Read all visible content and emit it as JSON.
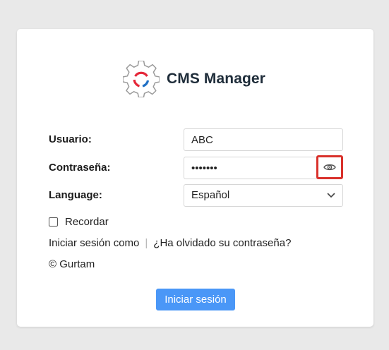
{
  "app": {
    "title": "CMS Manager"
  },
  "form": {
    "username": {
      "label": "Usuario:",
      "value": "ABC"
    },
    "password": {
      "label": "Contraseña:",
      "value": "1234567",
      "toggle_icon": "eye-icon"
    },
    "language": {
      "label": "Language:",
      "selected": "Español"
    },
    "remember": {
      "label": "Recordar",
      "checked": false
    },
    "links": {
      "login_as": "Iniciar sesión como",
      "separator": "|",
      "forgot": "¿Ha olvidado su contraseña?"
    },
    "copyright": "© Gurtam",
    "submit_label": "Iniciar sesión"
  },
  "colors": {
    "background": "#e9e9e9",
    "card": "#ffffff",
    "primary_button": "#4a97f7",
    "highlight_border": "#d9312b",
    "logo_red": "#e5283a",
    "logo_blue": "#1f6fc4",
    "logo_outline": "#9a9a9a"
  }
}
